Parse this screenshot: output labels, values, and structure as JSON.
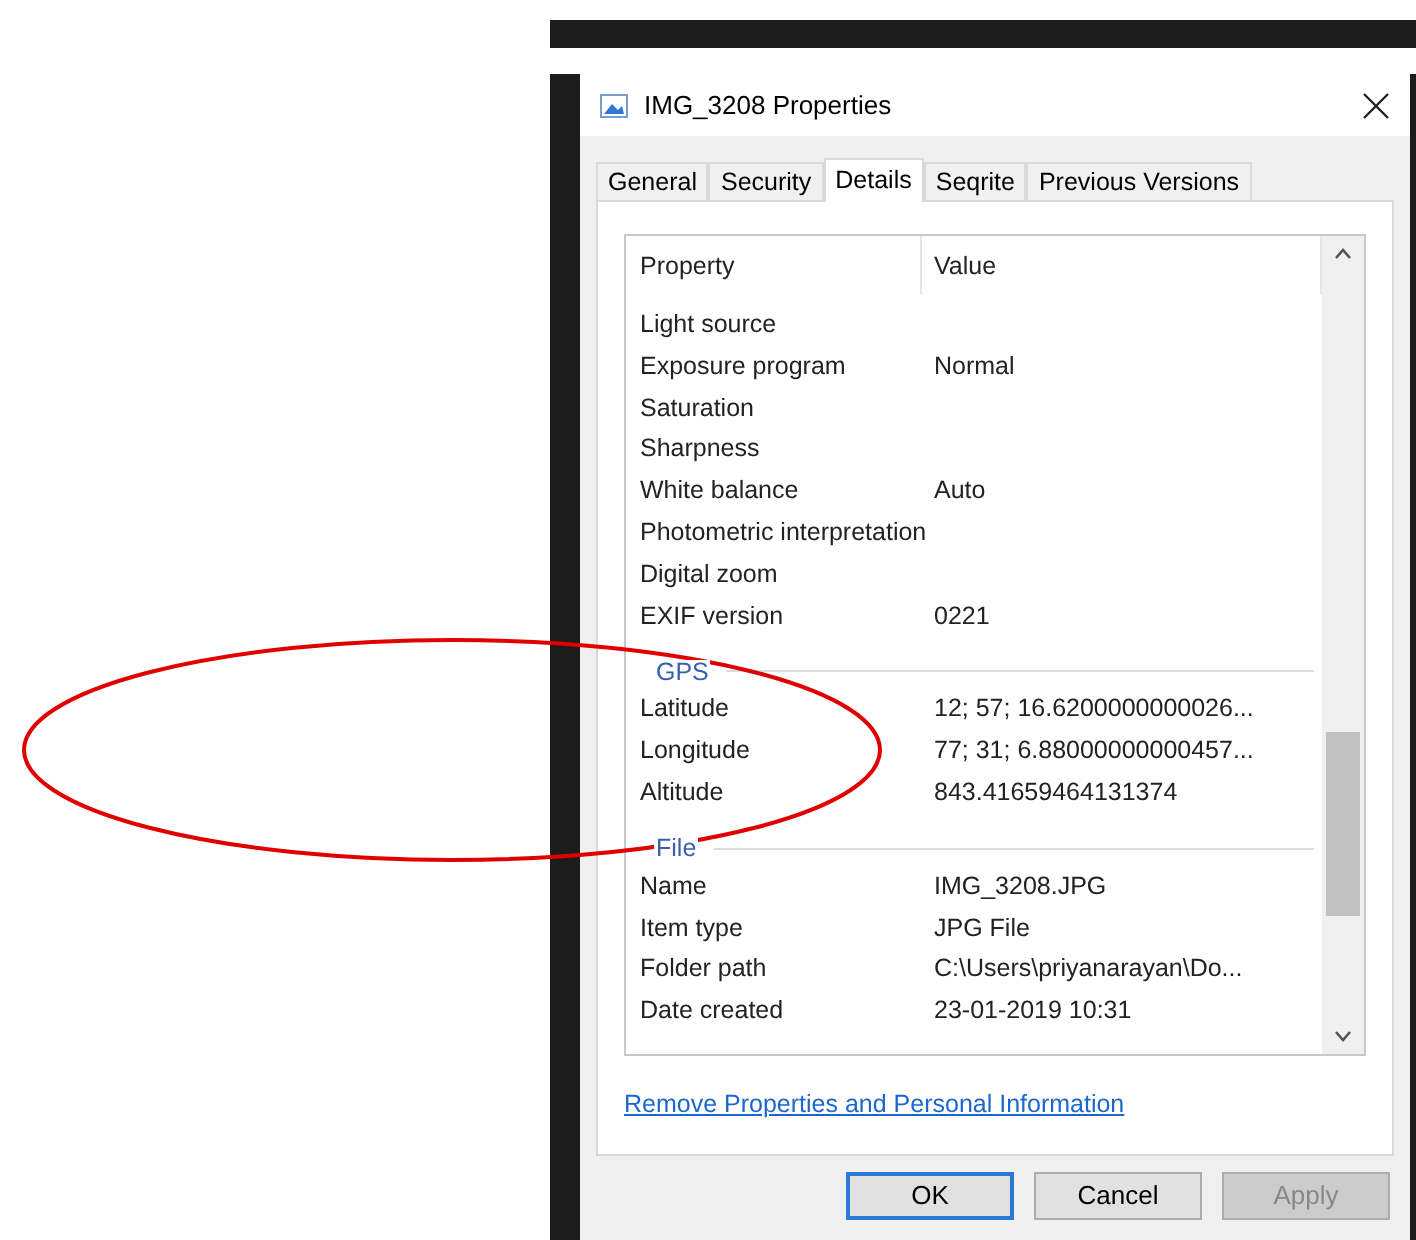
{
  "window": {
    "title": "IMG_3208 Properties"
  },
  "tabs": [
    {
      "label": "General",
      "selected": false
    },
    {
      "label": "Security",
      "selected": false
    },
    {
      "label": "Details",
      "selected": true
    },
    {
      "label": "Seqrite",
      "selected": false
    },
    {
      "label": "Previous Versions",
      "selected": false
    }
  ],
  "details": {
    "columns": [
      "Property",
      "Value"
    ],
    "groups": [
      {
        "rows": [
          {
            "property": "Light source"
          },
          {
            "property": "Exposure program",
            "value": "Normal"
          },
          {
            "property": "Saturation"
          },
          {
            "property": "Sharpness"
          },
          {
            "property": "White balance",
            "value": "Auto"
          },
          {
            "property": "Photometric interpretation"
          },
          {
            "property": "Digital zoom"
          },
          {
            "property": "EXIF version",
            "value": "0221"
          }
        ]
      },
      {
        "header": "GPS",
        "rows": [
          {
            "property": "Latitude",
            "value": "12; 57; 16.6200000000026..."
          },
          {
            "property": "Longitude",
            "value": "77; 31; 6.88000000000457..."
          },
          {
            "property": "Altitude",
            "value": "843.41659464131374"
          }
        ]
      },
      {
        "header": "File",
        "rows": [
          {
            "property": "Name",
            "value": "IMG_3208.JPG"
          },
          {
            "property": "Item type",
            "value": "JPG File"
          },
          {
            "property": "Folder path",
            "value": "C:\\Users\\priyanarayan\\Do..."
          },
          {
            "property": "Date created",
            "value": "23-01-2019 10:31"
          }
        ]
      }
    ]
  },
  "link": "Remove Properties and Personal Information",
  "buttons": [
    {
      "label": "OK",
      "default": true,
      "disabled": false
    },
    {
      "label": "Cancel",
      "default": false,
      "disabled": false
    },
    {
      "label": "Apply",
      "default": false,
      "disabled": true
    }
  ]
}
